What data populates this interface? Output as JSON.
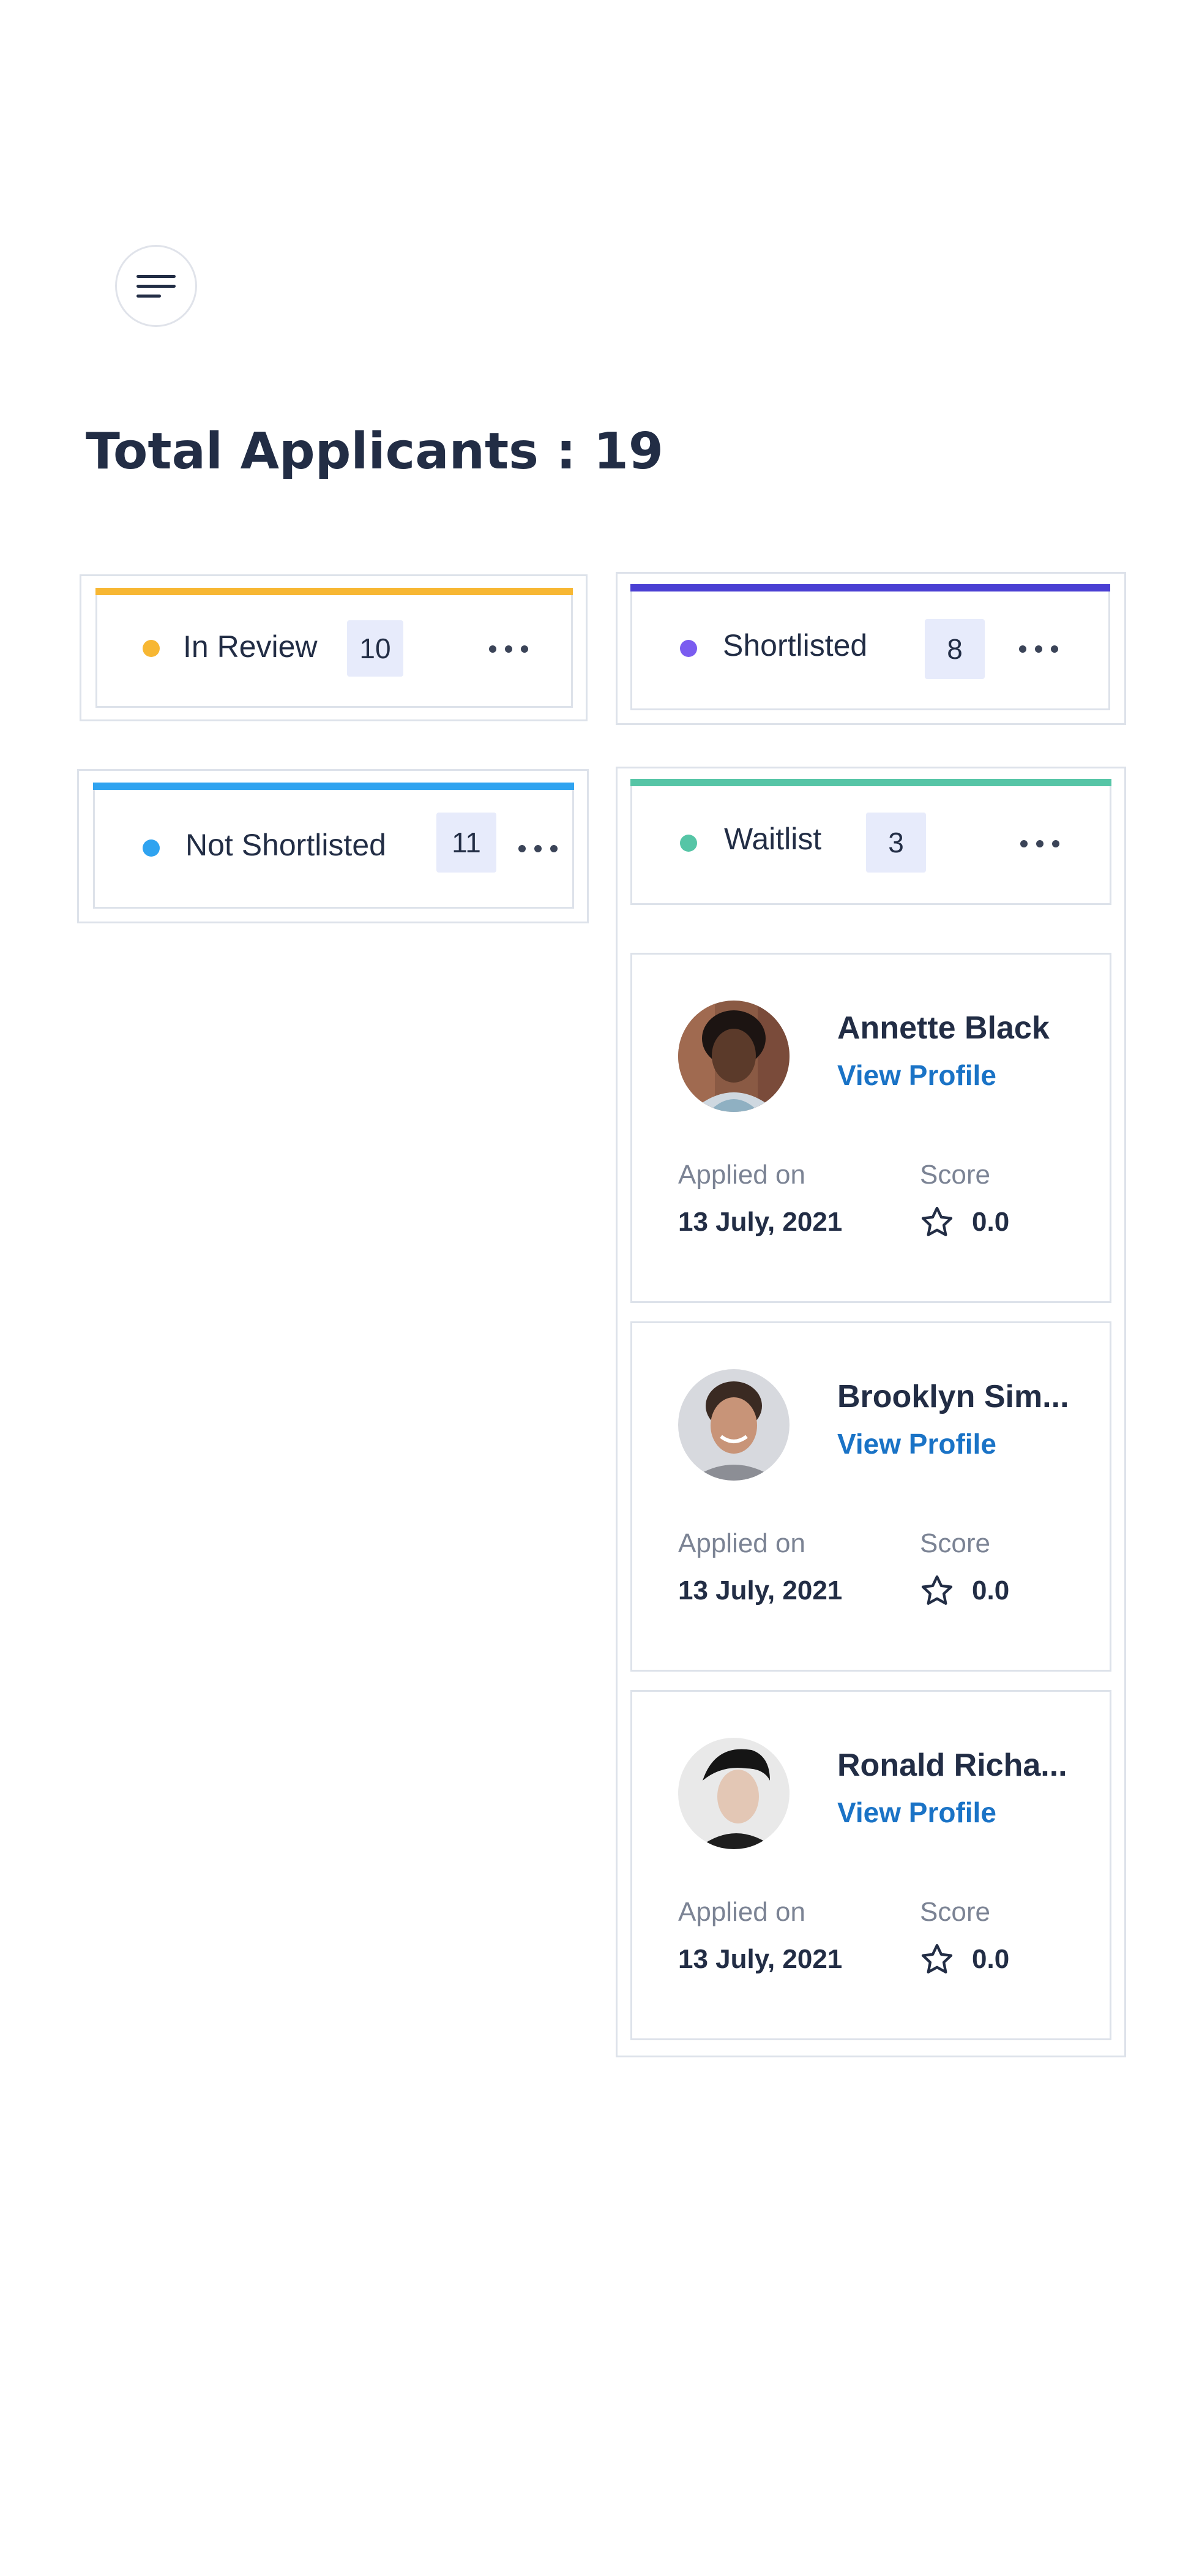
{
  "header": {
    "menu_icon": "hamburger-icon"
  },
  "title": "Total Applicants : 19",
  "columns": [
    {
      "label": "In Review",
      "count": "10",
      "color": "#f7b733"
    },
    {
      "label": "Shortlisted",
      "count": "8",
      "color": "#4a3fd3"
    },
    {
      "label": "Not Shortlisted",
      "count": "11",
      "color": "#2fa3f0"
    },
    {
      "label": "Waitlist",
      "count": "3",
      "color": "#56c5a6"
    }
  ],
  "dot_colors": {
    "in_review": "#f7b733",
    "shortlisted": "#7a5cf0",
    "not_shortlisted": "#2fa3f0",
    "waitlist": "#56c5a6"
  },
  "cards": [
    {
      "name": "Annette Black",
      "view_label": "View Profile",
      "applied_label": "Applied on",
      "applied_date": "13 July, 2021",
      "score_label": "Score",
      "score": "0.0"
    },
    {
      "name": "Brooklyn Sim...",
      "view_label": "View Profile",
      "applied_label": "Applied on",
      "applied_date": "13 July, 2021",
      "score_label": "Score",
      "score": "0.0"
    },
    {
      "name": "Ronald Richa...",
      "view_label": "View Profile",
      "applied_label": "Applied on",
      "applied_date": "13 July, 2021",
      "score_label": "Score",
      "score": "0.0"
    }
  ]
}
